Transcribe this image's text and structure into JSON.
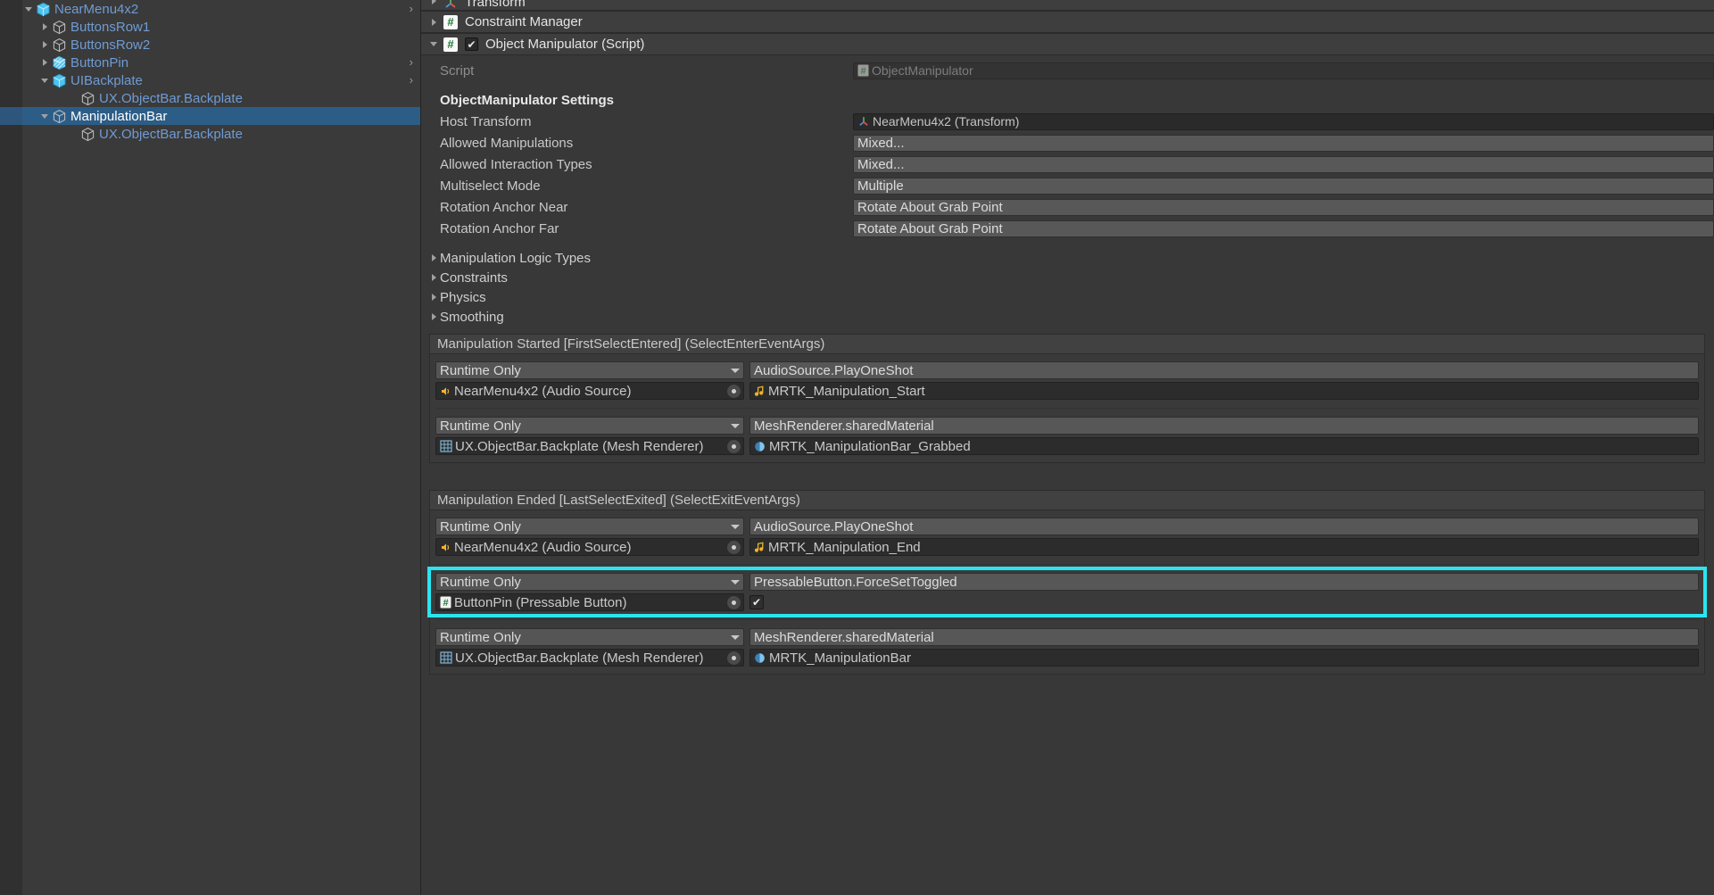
{
  "hierarchy": {
    "rows": [
      {
        "label": "NearMenu4x2",
        "indent": 22,
        "tri": "open",
        "icon": "prefab-cube-icon",
        "selected": false,
        "arrow": true
      },
      {
        "label": "ButtonsRow1",
        "indent": 40,
        "tri": "closed",
        "icon": "gameobject-cube-icon",
        "selected": false,
        "arrow": false
      },
      {
        "label": "ButtonsRow2",
        "indent": 40,
        "tri": "closed",
        "icon": "gameobject-cube-icon",
        "selected": false,
        "arrow": false
      },
      {
        "label": "ButtonPin",
        "indent": 40,
        "tri": "closed",
        "icon": "prefab-variant-cube-icon",
        "selected": false,
        "arrow": true
      },
      {
        "label": "UIBackplate",
        "indent": 40,
        "tri": "open",
        "icon": "prefab-cube-icon",
        "selected": false,
        "arrow": true
      },
      {
        "label": "UX.ObjectBar.Backplate",
        "indent": 72,
        "tri": "none",
        "icon": "gameobject-cube-icon",
        "selected": false,
        "arrow": false
      },
      {
        "label": "ManipulationBar",
        "indent": 40,
        "tri": "open",
        "icon": "gameobject-cube-icon",
        "selected": true,
        "arrow": false
      },
      {
        "label": "UX.ObjectBar.Backplate",
        "indent": 72,
        "tri": "none",
        "icon": "gameobject-cube-icon",
        "selected": false,
        "arrow": false
      }
    ]
  },
  "inspector": {
    "components": [
      {
        "title": "Transform",
        "icon": "transform-axis-icon",
        "expanded": false,
        "has_enable_checkbox": false
      },
      {
        "title": "Constraint Manager",
        "icon": "script-icon",
        "expanded": false,
        "has_enable_checkbox": false
      },
      {
        "title": "Object Manipulator (Script)",
        "icon": "script-icon",
        "expanded": true,
        "has_enable_checkbox": true,
        "enabled": true
      }
    ],
    "script_row": {
      "label": "Script",
      "value": "ObjectManipulator"
    },
    "section_header": "ObjectManipulator Settings",
    "properties": [
      {
        "label": "Host Transform",
        "value": "NearMenu4x2 (Transform)",
        "kind": "object",
        "icon": "transform-axis-icon"
      },
      {
        "label": "Allowed Manipulations",
        "value": "Mixed...",
        "kind": "popup"
      },
      {
        "label": "Allowed Interaction Types",
        "value": "Mixed...",
        "kind": "popup"
      },
      {
        "label": "Multiselect Mode",
        "value": "Multiple",
        "kind": "popup"
      },
      {
        "label": "Rotation Anchor Near",
        "value": "Rotate About Grab Point",
        "kind": "popup"
      },
      {
        "label": "Rotation Anchor Far",
        "value": "Rotate About Grab Point",
        "kind": "popup"
      }
    ],
    "foldouts": [
      {
        "label": "Manipulation Logic Types"
      },
      {
        "label": "Constraints"
      },
      {
        "label": "Physics"
      },
      {
        "label": "Smoothing"
      }
    ],
    "events": [
      {
        "title": "Manipulation Started [FirstSelectEntered] (SelectEnterEventArgs)",
        "entries": [
          {
            "highlight": false,
            "call_state": "Runtime Only",
            "method": "AudioSource.PlayOneShot",
            "target": "NearMenu4x2 (Audio Source)",
            "target_icon": "audio-source-icon",
            "argument": "MRTK_Manipulation_Start",
            "argument_icon": "audio-clip-icon",
            "argument_kind": "object"
          },
          {
            "highlight": false,
            "call_state": "Runtime Only",
            "method": "MeshRenderer.sharedMaterial",
            "target": "UX.ObjectBar.Backplate (Mesh Renderer)",
            "target_icon": "mesh-renderer-icon",
            "argument": "MRTK_ManipulationBar_Grabbed",
            "argument_icon": "material-icon",
            "argument_kind": "object"
          }
        ]
      },
      {
        "title": "Manipulation Ended [LastSelectExited] (SelectExitEventArgs)",
        "entries": [
          {
            "highlight": false,
            "call_state": "Runtime Only",
            "method": "AudioSource.PlayOneShot",
            "target": "NearMenu4x2 (Audio Source)",
            "target_icon": "audio-source-icon",
            "argument": "MRTK_Manipulation_End",
            "argument_icon": "audio-clip-icon",
            "argument_kind": "object"
          },
          {
            "highlight": true,
            "call_state": "Runtime Only",
            "method": "PressableButton.ForceSetToggled",
            "target": "ButtonPin (Pressable Button)",
            "target_icon": "script-icon",
            "argument": "",
            "argument_icon": "checkbox-checked-icon",
            "argument_kind": "bool",
            "argument_checked": true
          },
          {
            "highlight": false,
            "call_state": "Runtime Only",
            "method": "MeshRenderer.sharedMaterial",
            "target": "UX.ObjectBar.Backplate (Mesh Renderer)",
            "target_icon": "mesh-renderer-icon",
            "argument": "MRTK_ManipulationBar",
            "argument_icon": "material-icon",
            "argument_kind": "object"
          }
        ]
      }
    ]
  },
  "colors": {
    "highlight": "#2ae5f0",
    "selection": "#2c5d87",
    "hierarchy_text": "#6f9bd4",
    "panel_bg": "#383838"
  }
}
